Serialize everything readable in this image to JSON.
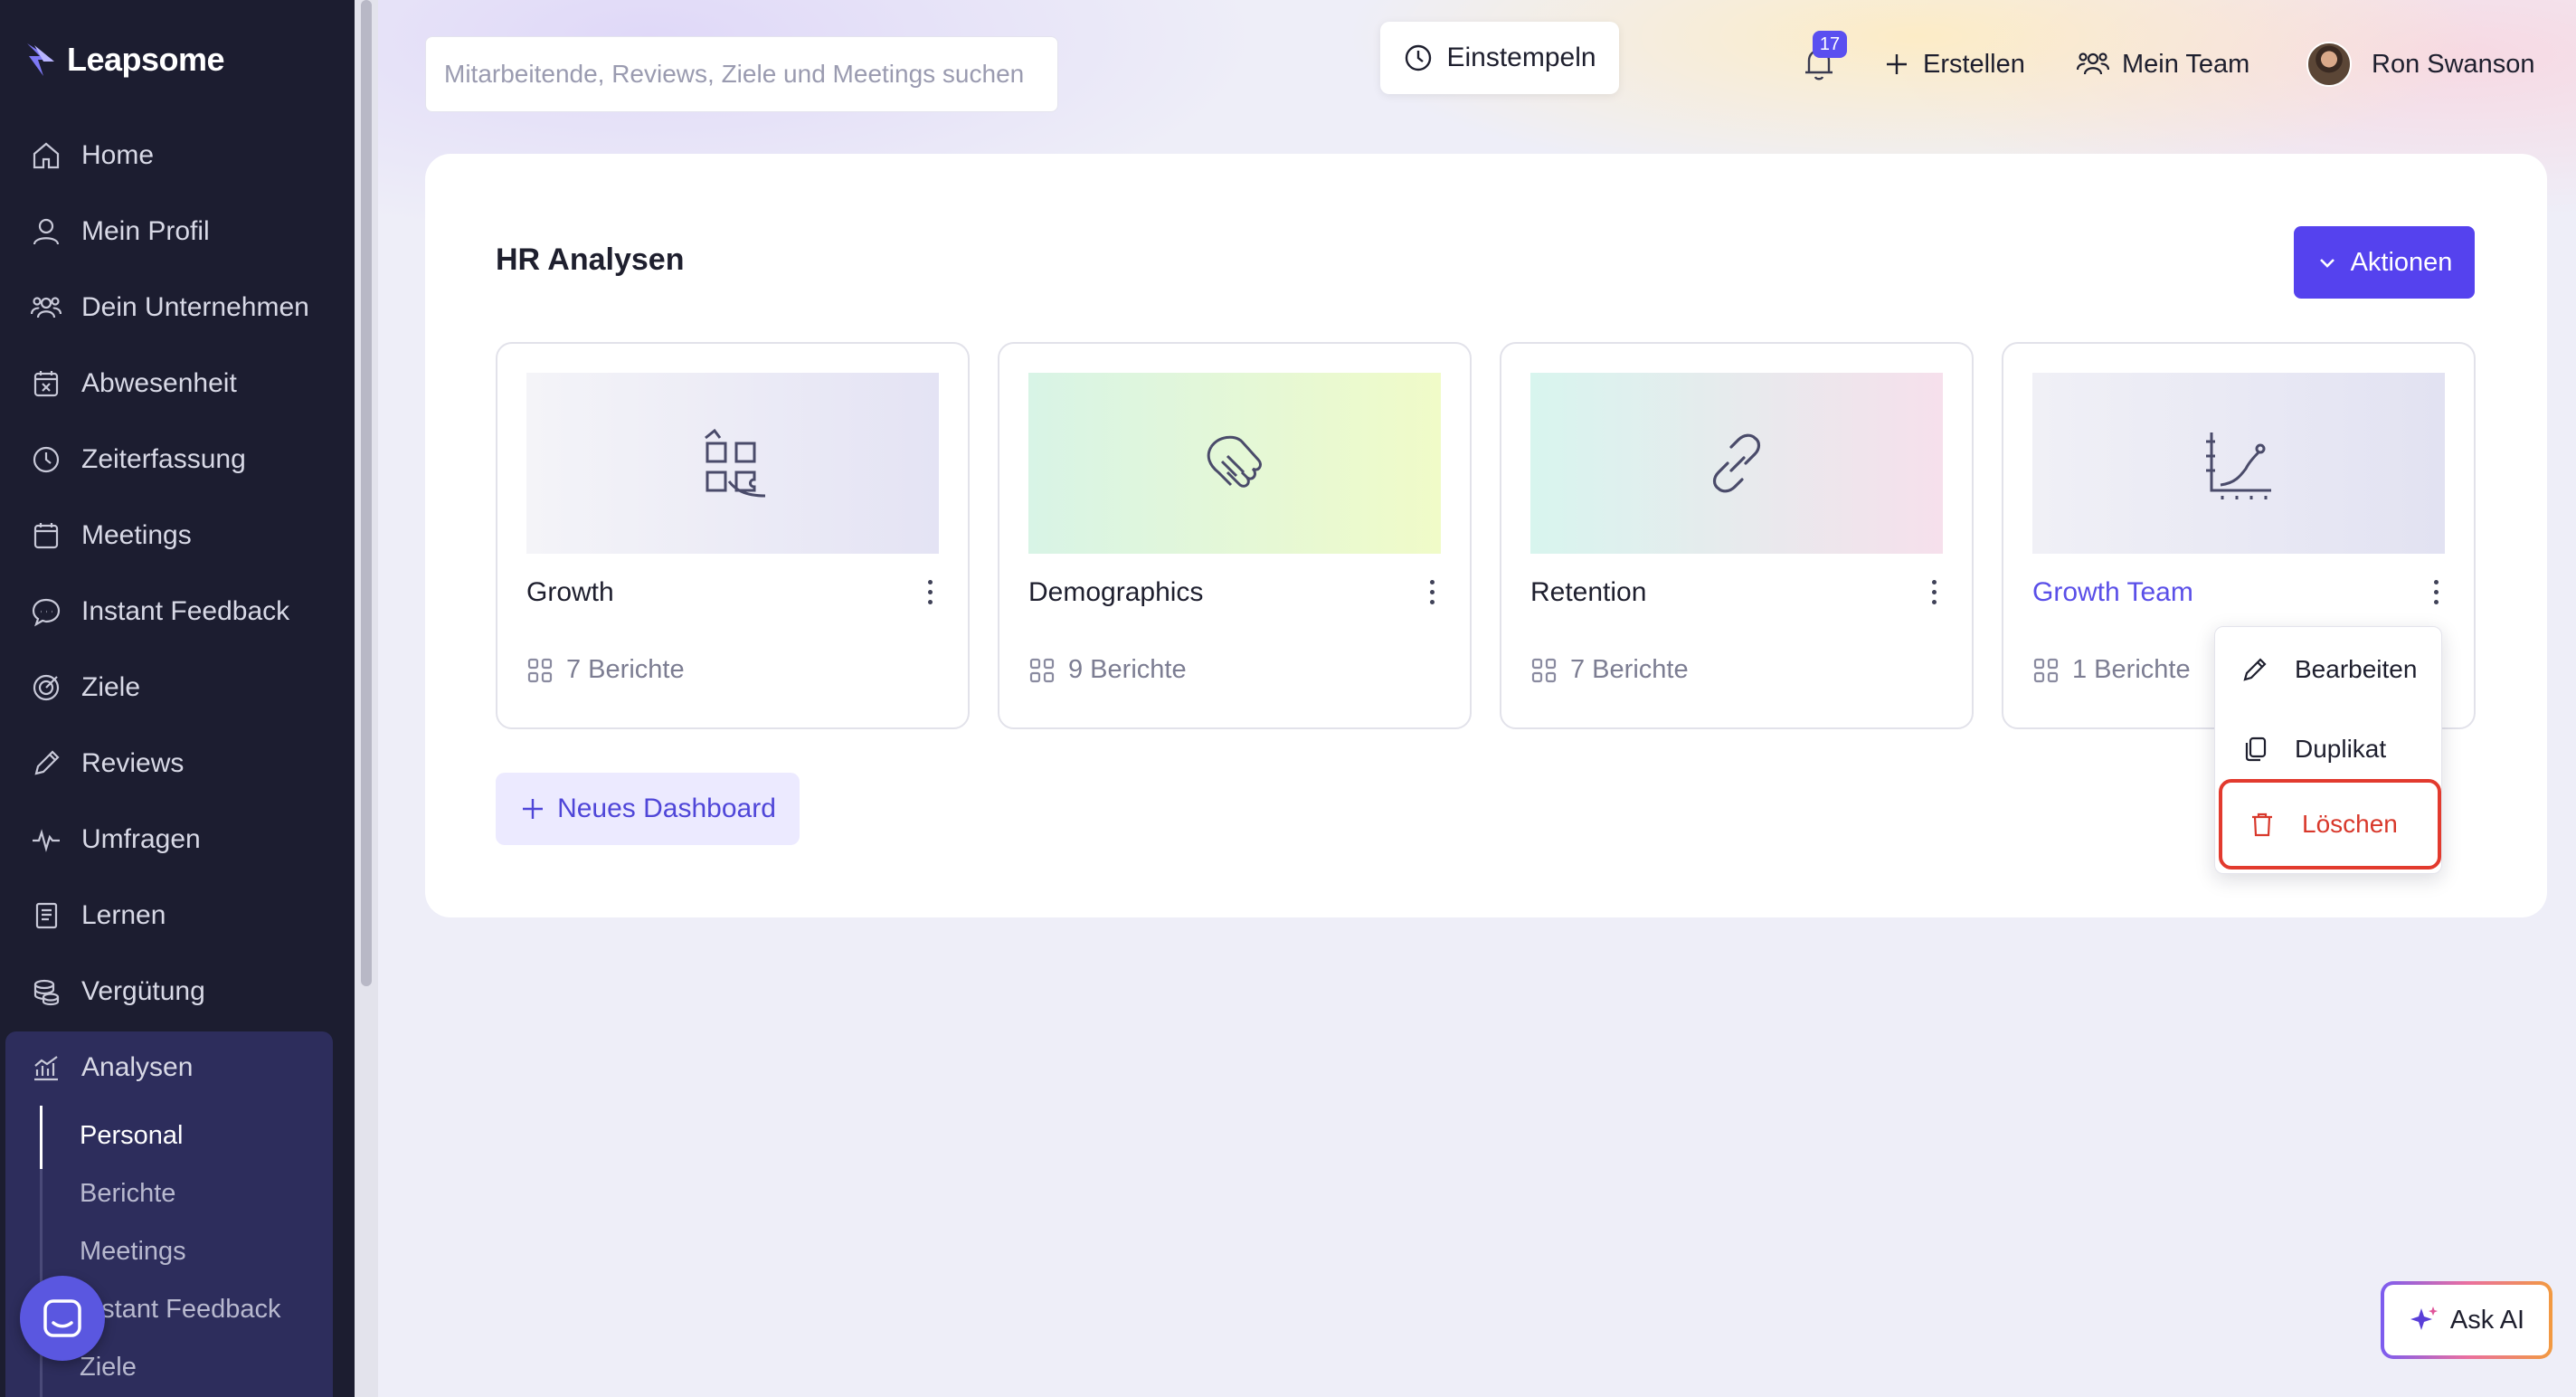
{
  "brand": {
    "name": "Leapsome"
  },
  "sidebar": {
    "items": [
      {
        "label": "Home",
        "icon": "home-icon"
      },
      {
        "label": "Mein Profil",
        "icon": "user-icon"
      },
      {
        "label": "Dein Unternehmen",
        "icon": "people-icon"
      },
      {
        "label": "Abwesenheit",
        "icon": "calendar-x-icon"
      },
      {
        "label": "Zeiterfassung",
        "icon": "clock-icon"
      },
      {
        "label": "Meetings",
        "icon": "calendar-icon"
      },
      {
        "label": "Instant Feedback",
        "icon": "chat-bubble-icon"
      },
      {
        "label": "Ziele",
        "icon": "target-icon"
      },
      {
        "label": "Reviews",
        "icon": "pencil-icon"
      },
      {
        "label": "Umfragen",
        "icon": "pulse-icon"
      },
      {
        "label": "Lernen",
        "icon": "book-icon"
      },
      {
        "label": "Vergütung",
        "icon": "coins-icon"
      },
      {
        "label": "Analysen",
        "icon": "chart-icon",
        "expanded": true
      }
    ],
    "analysen_sub": [
      {
        "label": "Personal",
        "active": true
      },
      {
        "label": "Berichte"
      },
      {
        "label": "Meetings"
      },
      {
        "label": "Instant Feedback"
      },
      {
        "label": "Ziele"
      }
    ]
  },
  "header": {
    "search_placeholder": "Mitarbeitende, Reviews, Ziele und Meetings suchen",
    "clock_in_label": "Einstempeln",
    "notifications_count": "17",
    "create_label": "Erstellen",
    "team_label": "Mein Team",
    "user_name": "Ron Swanson"
  },
  "main": {
    "title": "HR Analysen",
    "actions_label": "Aktionen",
    "new_dashboard_label": "Neues Dashboard",
    "dashboards": [
      {
        "name": "Growth",
        "reports": "7 Berichte",
        "icon": "puzzle-hand-icon",
        "highlighted": false
      },
      {
        "name": "Demographics",
        "reports": "9 Berichte",
        "icon": "handshake-icon",
        "highlighted": false
      },
      {
        "name": "Retention",
        "reports": "7 Berichte",
        "icon": "link-icon",
        "highlighted": false
      },
      {
        "name": "Growth Team",
        "reports": "1 Berichte",
        "icon": "growth-chart-icon",
        "highlighted": true
      }
    ]
  },
  "context_menu": {
    "items": [
      {
        "label": "Bearbeiten",
        "icon": "pencil-icon"
      },
      {
        "label": "Duplikat",
        "icon": "copy-icon"
      },
      {
        "label": "Löschen",
        "icon": "trash-icon",
        "danger": true
      }
    ]
  },
  "ask_ai": {
    "label": "Ask AI"
  },
  "colors": {
    "sidebar_bg": "#1c1d30",
    "accent": "#5542ee",
    "link": "#5a4fe8",
    "danger": "#e23a2e"
  }
}
